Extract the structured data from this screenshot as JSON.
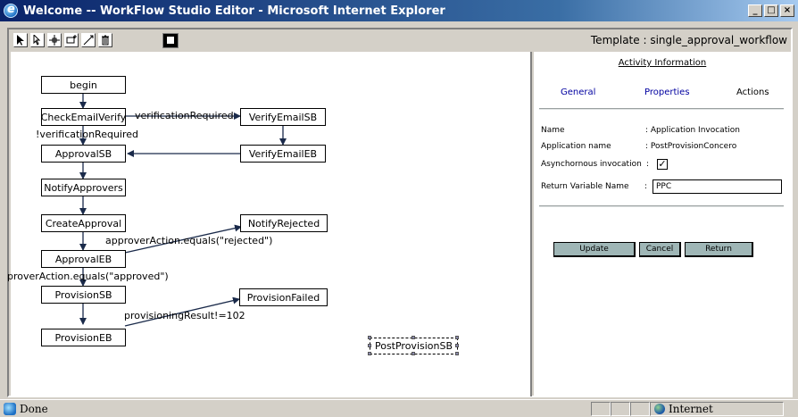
{
  "window": {
    "title": "Welcome -- WorkFlow Studio Editor - Microsoft Internet Explorer",
    "controls": [
      "minimize",
      "maximize",
      "close"
    ]
  },
  "toolbar": {
    "tools": [
      "select-arrow-icon",
      "pointer-icon",
      "move-icon",
      "add-node-icon",
      "connector-icon",
      "delete-icon"
    ],
    "save_icon": "save-disk-icon",
    "template_label": "Template : single_approval_workflow"
  },
  "workflow": {
    "nodes": {
      "begin": "begin",
      "check_email_verify": "CheckEmailVerify",
      "verify_email_sb": "VerifyEmailSB",
      "verify_email_eb": "VerifyEmailEB",
      "approval_sb": "ApprovalSB",
      "notify_approvers": "NotifyApprovers",
      "create_approval": "CreateApproval",
      "notify_rejected": "NotifyRejected",
      "approval_eb": "ApprovalEB",
      "provision_sb": "ProvisionSB",
      "provision_failed": "ProvisionFailed",
      "provision_eb": "ProvisionEB",
      "post_provision_sb": "PostProvisionSB"
    },
    "edge_labels": {
      "verification_required": "verificationRequired",
      "not_verification_required": "!verificationRequired",
      "rejected": "approverAction.equals(\"rejected\")",
      "approved": "proverAction.equals(\"approved\")",
      "provisioning_result": "provisioningResult!=102"
    }
  },
  "panel": {
    "title": "Activity Information",
    "tabs": {
      "general": "General",
      "properties": "Properties",
      "actions": "Actions"
    },
    "fields": {
      "name_label": "Name",
      "name_value": ": Application Invocation",
      "app_name_label": "Application name",
      "app_name_value": ": PostProvisionConcero",
      "async_label": "Asynchornous invocation",
      "async_sep": ":",
      "async_checked": true,
      "return_var_label": "Return Variable Name",
      "return_var_sep": ":",
      "return_var_value": "PPC"
    },
    "buttons": {
      "update": "Update",
      "cancel": "Cancel",
      "return": "Return"
    }
  },
  "status": {
    "text": "Done",
    "zone": "Internet"
  },
  "colors": {
    "titlebar": "#0a246a",
    "button_face": "#9fb6b6",
    "link_tab": "#0000a0"
  }
}
